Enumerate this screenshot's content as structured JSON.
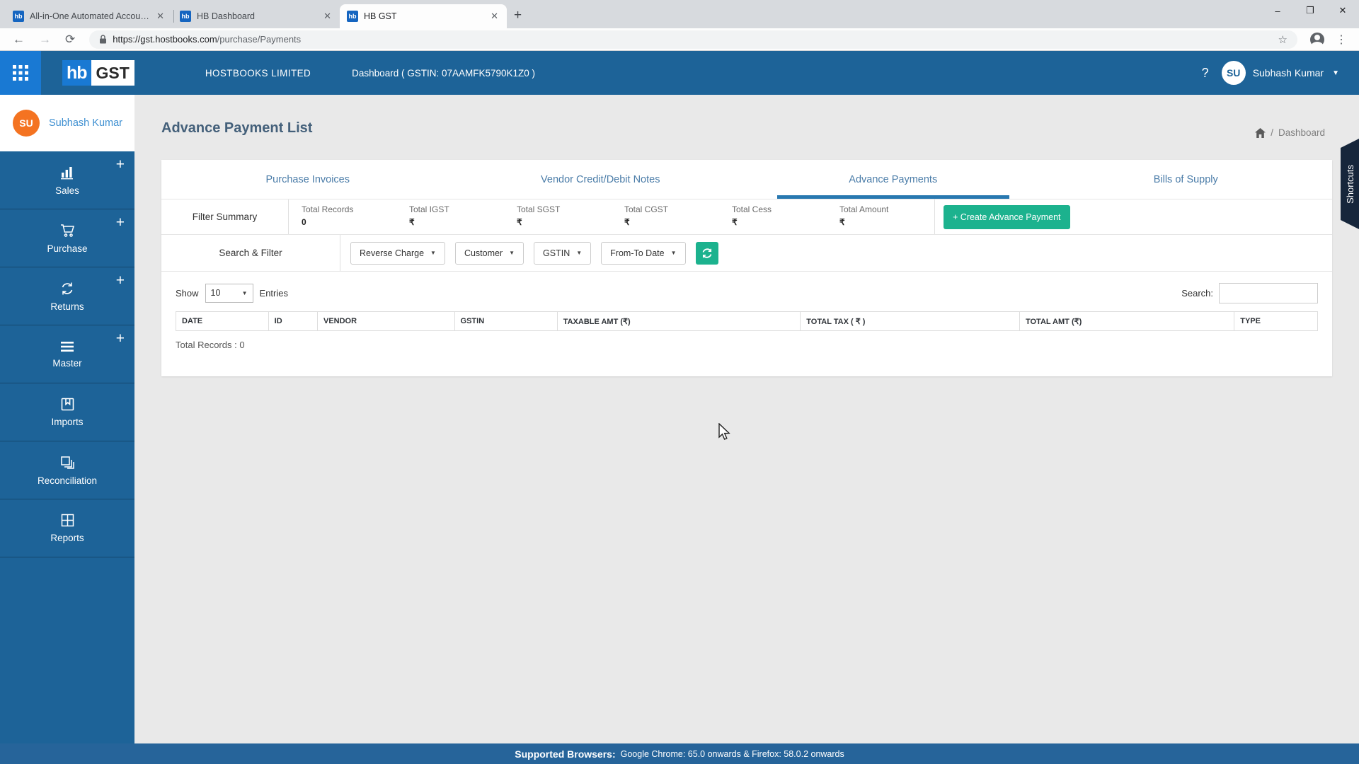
{
  "browser": {
    "favicon_text": "hb",
    "tabs": [
      {
        "title": "All-in-One Automated Accountin"
      },
      {
        "title": "HB Dashboard"
      },
      {
        "title": "HB GST"
      }
    ],
    "url_host": "https://gst.hostbooks.com",
    "url_path": "/purchase/Payments"
  },
  "navbar": {
    "logo_hb": "hb",
    "logo_gst": "GST",
    "company": "HOSTBOOKS LIMITED",
    "dashboard_label": "Dashboard ( GSTIN: 07AAMFK5790K1Z0 )",
    "user_initials": "SU",
    "user_name": "Subhash Kumar"
  },
  "sidebar": {
    "user_initials": "SU",
    "user_name": "Subhash Kumar",
    "items": [
      {
        "label": "Sales"
      },
      {
        "label": "Purchase"
      },
      {
        "label": "Returns"
      },
      {
        "label": "Master"
      },
      {
        "label": "Imports"
      },
      {
        "label": "Reconciliation"
      },
      {
        "label": "Reports"
      }
    ]
  },
  "page": {
    "title": "Advance Payment List",
    "breadcrumb": "Dashboard",
    "shortcuts": "Shortcuts"
  },
  "content": {
    "tabs": [
      {
        "label": "Purchase Invoices"
      },
      {
        "label": "Vendor Credit/Debit Notes"
      },
      {
        "label": "Advance Payments"
      },
      {
        "label": "Bills of Supply"
      }
    ]
  },
  "filter": {
    "label": "Filter Summary",
    "stats": [
      {
        "label": "Total Records",
        "value": "0"
      },
      {
        "label": "Total IGST",
        "value": "₹"
      },
      {
        "label": "Total SGST",
        "value": "₹"
      },
      {
        "label": "Total CGST",
        "value": "₹"
      },
      {
        "label": "Total Cess",
        "value": "₹"
      },
      {
        "label": "Total Amount",
        "value": "₹"
      }
    ],
    "create_button": "+ Create Advance Payment"
  },
  "search_filter": {
    "label": "Search & Filter",
    "dropdowns": [
      {
        "label": "Reverse Charge"
      },
      {
        "label": "Customer"
      },
      {
        "label": "GSTIN"
      },
      {
        "label": "From-To Date"
      }
    ]
  },
  "entries": {
    "show_label": "Show",
    "per_page": "10",
    "entries_label": "Entries",
    "search_label": "Search:",
    "search_value": ""
  },
  "table": {
    "headers": [
      "DATE",
      "ID",
      "VENDOR",
      "GSTIN",
      "TAXABLE AMT (₹)",
      "TOTAL TAX ( ₹ )",
      "TOTAL AMT (₹)",
      "TYPE"
    ],
    "total_records": "Total Records : 0"
  },
  "footer": {
    "bold": "Supported Browsers:",
    "rest": "Google Chrome: 65.0 onwards & Firefox: 58.0.2 onwards"
  }
}
